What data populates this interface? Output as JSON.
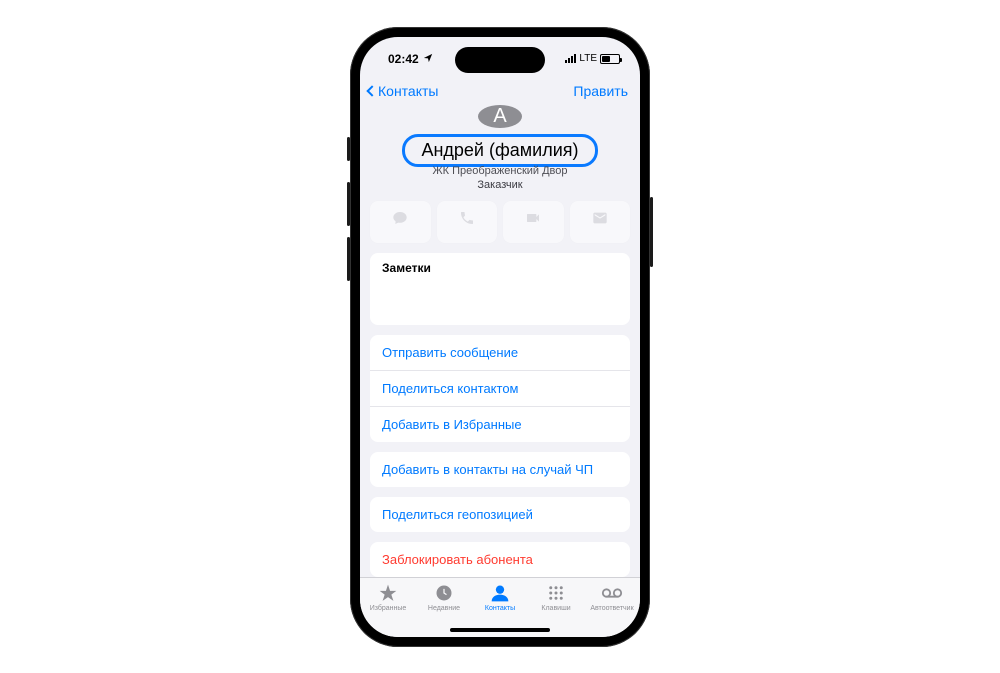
{
  "status": {
    "time": "02:42",
    "network": "LTE"
  },
  "nav": {
    "back": "Контакты",
    "edit": "Править"
  },
  "contact": {
    "initial": "А",
    "name": "Андрей  (фамилия)",
    "line1": "ЖК Преображенский Двор",
    "line2": "Заказчик"
  },
  "actions": {
    "message": "",
    "call": "",
    "video": "",
    "mail": ""
  },
  "notes": {
    "label": "Заметки"
  },
  "links": {
    "send_message": "Отправить сообщение",
    "share_contact": "Поделиться контактом",
    "add_favorites": "Добавить в Избранные",
    "emergency": "Добавить в контакты на случай ЧП",
    "share_location": "Поделиться геопозицией",
    "block": "Заблокировать абонента"
  },
  "tabs": {
    "favorites": "Избранные",
    "recents": "Недавние",
    "contacts": "Контакты",
    "keypad": "Клавиши",
    "voicemail": "Автоответчик"
  }
}
